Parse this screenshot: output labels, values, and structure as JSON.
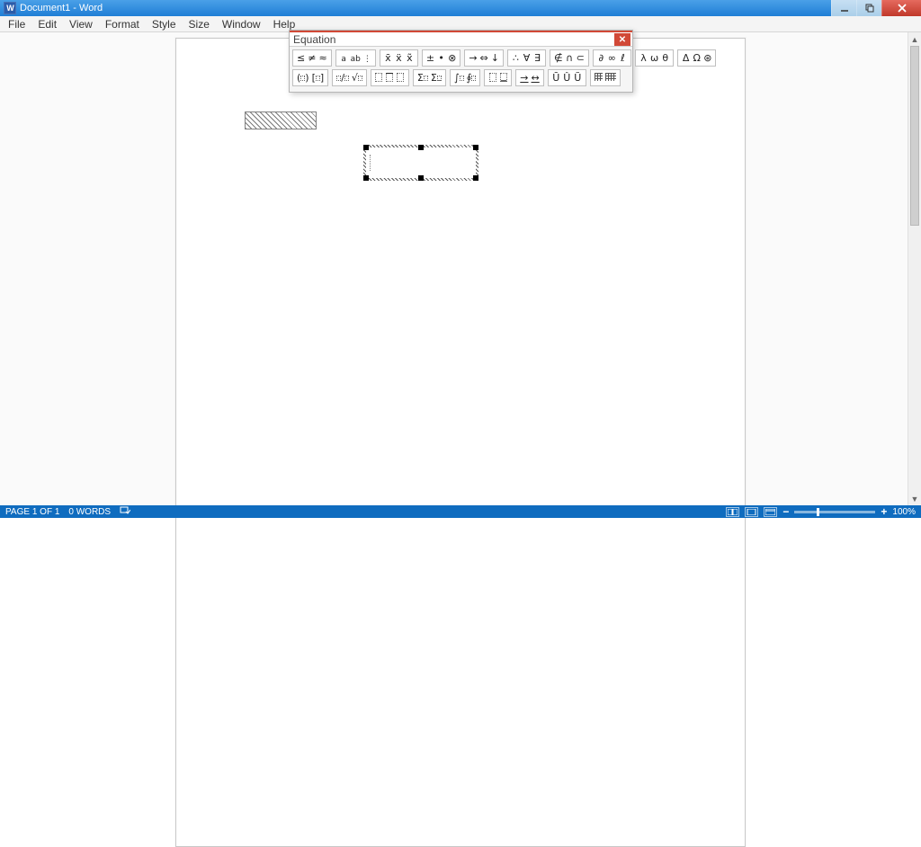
{
  "window": {
    "title": "Document1 - Word",
    "app_icon_text": "W"
  },
  "menu": [
    "File",
    "Edit",
    "View",
    "Format",
    "Style",
    "Size",
    "Window",
    "Help"
  ],
  "equation": {
    "title": "Equation",
    "row1": [
      [
        "≤",
        "≠",
        "≈"
      ],
      [
        "↓a",
        "a↓",
        "↓̣"
      ],
      [
        "x̄",
        "ẍ",
        "x̃"
      ],
      [
        "±",
        "•",
        "⊗"
      ],
      [
        "→",
        "⇔",
        "↓"
      ],
      [
        "∴",
        "∀",
        "∃"
      ],
      [
        "∉",
        "∩",
        "⊂"
      ],
      [
        "∂",
        "∞",
        "ℓ"
      ],
      [
        "λ",
        "ω",
        "θ"
      ],
      [
        "Δ",
        "Ω",
        "⊛"
      ]
    ],
    "row2": [
      [
        "(▯)",
        "[▯]"
      ],
      [
        "▯/▯",
        "√▯"
      ],
      [
        "▯̂",
        "▯̅",
        "▯̃"
      ],
      [
        "Σ▯",
        "Σ▯̣"
      ],
      [
        "∫▯",
        "∮▯"
      ],
      [
        "▯_",
        "▯̲"
      ],
      [
        "→̲",
        "↔̲"
      ],
      [
        "Ū",
        "Û",
        "Ũ"
      ],
      [
        "▦",
        "▦▦"
      ]
    ]
  },
  "status": {
    "page": "PAGE 1 OF 1",
    "words": "0 WORDS",
    "zoom": "100%"
  }
}
